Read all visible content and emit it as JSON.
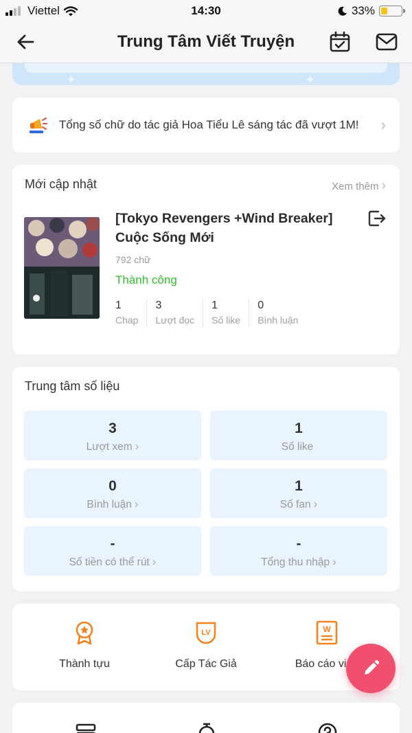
{
  "status_bar": {
    "carrier": "Viettel",
    "time": "14:30",
    "battery": "33%"
  },
  "header": {
    "title": "Trung Tâm Viết Truyện"
  },
  "notice": {
    "text": "Tổng số chữ do tác giả Hoa Tiểu Lê sáng tác đã vượt 1M!"
  },
  "updates": {
    "heading": "Mới cập nhật",
    "more": "Xem thêm",
    "story": {
      "title": "[Tokyo Revengers +Wind Breaker] Cuộc Sống Mới",
      "words": "792 chữ",
      "status": "Thành công",
      "stats": [
        {
          "value": "1",
          "label": "Chap"
        },
        {
          "value": "3",
          "label": "Lượt đọc"
        },
        {
          "value": "1",
          "label": "Số like"
        },
        {
          "value": "0",
          "label": "Bình luận"
        }
      ]
    }
  },
  "metrics": {
    "heading": "Trung tâm số liệu",
    "tiles": [
      {
        "value": "3",
        "label": "Lượt xem",
        "arrow": "›"
      },
      {
        "value": "1",
        "label": "Số like",
        "arrow": ""
      },
      {
        "value": "0",
        "label": "Bình luận",
        "arrow": "›"
      },
      {
        "value": "1",
        "label": "Số fan",
        "arrow": "›"
      },
      {
        "value": "-",
        "label": "Số tiền có thể rút",
        "arrow": "›"
      },
      {
        "value": "-",
        "label": "Tổng thu nhập",
        "arrow": "›"
      }
    ]
  },
  "tools": [
    {
      "label": "Thành tựu",
      "icon": "medal-icon"
    },
    {
      "label": "Cấp Tác Giả",
      "icon": "level-icon"
    },
    {
      "label": "Báo cáo vinh",
      "icon": "report-icon"
    }
  ],
  "colors": {
    "accent": "#f5821f",
    "fab": "#f0506e",
    "success": "#2fbf2f",
    "tile_bg": "#eaf4fe"
  }
}
